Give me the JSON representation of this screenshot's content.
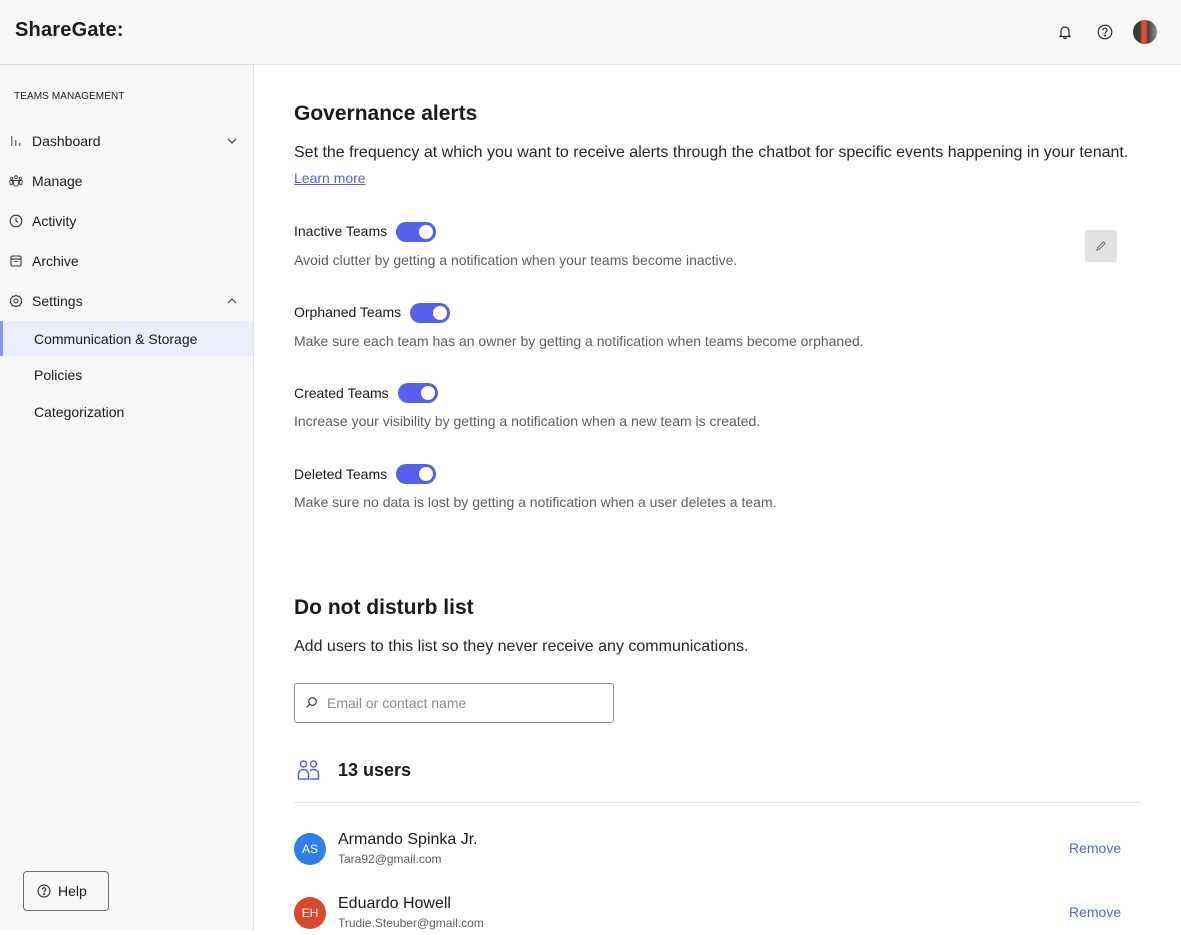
{
  "app": {
    "brand": "ShareGate:",
    "header_icons": [
      "bell-icon",
      "help-circle-icon",
      "user-avatar"
    ]
  },
  "sidebar": {
    "section_label": "TEAMS MANAGEMENT",
    "items": [
      {
        "label": "Dashboard",
        "icon": "bar-chart-icon",
        "chevron": "down"
      },
      {
        "label": "Manage",
        "icon": "people-group-icon"
      },
      {
        "label": "Activity",
        "icon": "clock-icon"
      },
      {
        "label": "Archive",
        "icon": "archive-box-icon"
      },
      {
        "label": "Settings",
        "icon": "gear-icon",
        "chevron": "up"
      }
    ],
    "sub_items": [
      {
        "label": "Communication & Storage",
        "active": true
      },
      {
        "label": "Policies",
        "active": false
      },
      {
        "label": "Categorization",
        "active": false
      }
    ],
    "help_label": "Help"
  },
  "governance": {
    "title": "Governance alerts",
    "description": "Set the frequency at which you want to receive alerts through the chatbot for specific events happening in your tenant.",
    "learn_more": "Learn more",
    "alerts": [
      {
        "title": "Inactive Teams",
        "enabled": true,
        "description": "Avoid clutter by getting a notification when your teams become inactive."
      },
      {
        "title": "Orphaned Teams",
        "enabled": true,
        "description": "Make sure each team has an owner by getting a notification when teams become orphaned."
      },
      {
        "title": "Created Teams",
        "enabled": true,
        "description": "Increase your visibility by getting a notification when a new team is created."
      },
      {
        "title": "Deleted Teams",
        "enabled": true,
        "description": "Make sure no data is lost by getting a notification when a user deletes a team."
      }
    ]
  },
  "dnd": {
    "title": "Do not disturb list",
    "description": "Add users to this list so they never receive any communications.",
    "search_placeholder": "Email or contact name",
    "search_value": "",
    "count_label": "13 users",
    "remove_label": "Remove",
    "users": [
      {
        "initials": "AS",
        "name": "Armando Spinka Jr.",
        "email": "Tara92@gmail.com",
        "color": "#2f80ed"
      },
      {
        "initials": "EH",
        "name": "Eduardo Howell",
        "email": "Trudie.Steuber@gmail.com",
        "color": "#d9482b"
      }
    ]
  },
  "colors": {
    "accent": "#5660ea",
    "link": "#5360e8",
    "active_nav_bg": "#eaeefb"
  }
}
